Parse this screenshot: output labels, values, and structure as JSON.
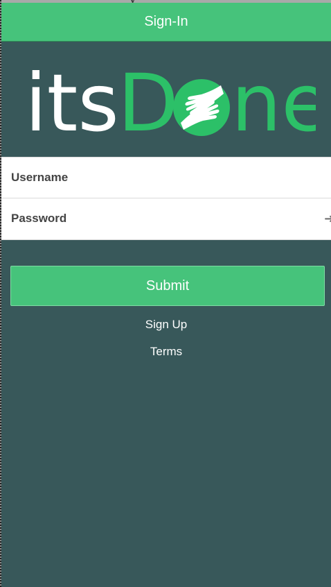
{
  "header": {
    "title": "Sign-In",
    "brand_color": "#46c37b"
  },
  "logo": {
    "prefix": "its",
    "suffix": "ne",
    "d_letter": "D",
    "icon": "helping-hands-icon",
    "prefix_color": "#ffffff",
    "accent_color": "#2cc068"
  },
  "form": {
    "username": {
      "placeholder": "Username",
      "value": ""
    },
    "password": {
      "placeholder": "Password",
      "value": ""
    }
  },
  "actions": {
    "submit_label": "Submit",
    "signup_label": "Sign Up",
    "terms_label": "Terms"
  },
  "theme": {
    "background": "#38585a",
    "field_background": "#ffffff"
  }
}
